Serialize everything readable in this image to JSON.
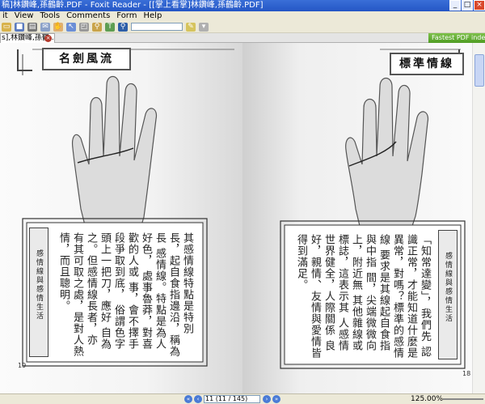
{
  "window": {
    "title": "稿]林鑽峰,孫鶴齡.PDF - Foxit Reader - [[掌上看掌]林鑽峰,孫鶴齡.PDF]",
    "controls": [
      "_",
      "□",
      "×"
    ]
  },
  "menu": [
    "it",
    "View",
    "Tools",
    "Comments",
    "Form",
    "Help"
  ],
  "toolbar": {
    "icons": [
      "open-icon",
      "save-icon",
      "print-icon",
      "email-icon",
      "hand-icon",
      "select-icon",
      "snapshot-icon",
      "zoom-icon",
      "typewriter-icon",
      "search-icon",
      "note-icon"
    ],
    "search_value": ""
  },
  "tabbar": {
    "tab_label": "s],林鑽峰,孫鶴...",
    "promo": "Fastest PDF index & sea"
  },
  "left_page": {
    "heading": "名劍風流",
    "body_columns": [
      "其感情線特點是特別",
      "長，起自食指邊沿，稱為長",
      "感情線。特點是為人好色，",
      "處事魯莽，對喜歡的人或",
      "事，會不擇手段爭取到底，",
      "俗謂色字頭上一把刀，應好",
      "自為之。但感情線長者，亦",
      "有其可取之處，是對人熱",
      "情，而且聰明。"
    ],
    "side_label": "感情線與感情生活",
    "page_number": "19"
  },
  "right_page": {
    "heading": "標準情線",
    "body_columns": [
      "「知常達變」，我們先",
      "認識正常，才能知道什麼是",
      "異常，對嗎？標準的感情線",
      "要求是其線起自食指與中指",
      "間，尖端微微向上，附近無",
      "其他雜線或標誌，這表示其",
      "人感情世界健全，人際關係",
      "良好，親情、友情與愛情皆",
      "得到滿足。"
    ],
    "side_label": "感情線與感情生活",
    "page_number": "18"
  },
  "status": {
    "page_display": "11 (11 / 145)",
    "zoom": "125.00%",
    "nav_buttons": [
      "first-page-icon",
      "prev-page-icon",
      "next-page-icon",
      "last-page-icon"
    ]
  },
  "colors": {
    "titlebar": "#2456c5",
    "menubar": "#ece9d8",
    "close_button": "#d9492c",
    "promo": "#4f9c23"
  }
}
